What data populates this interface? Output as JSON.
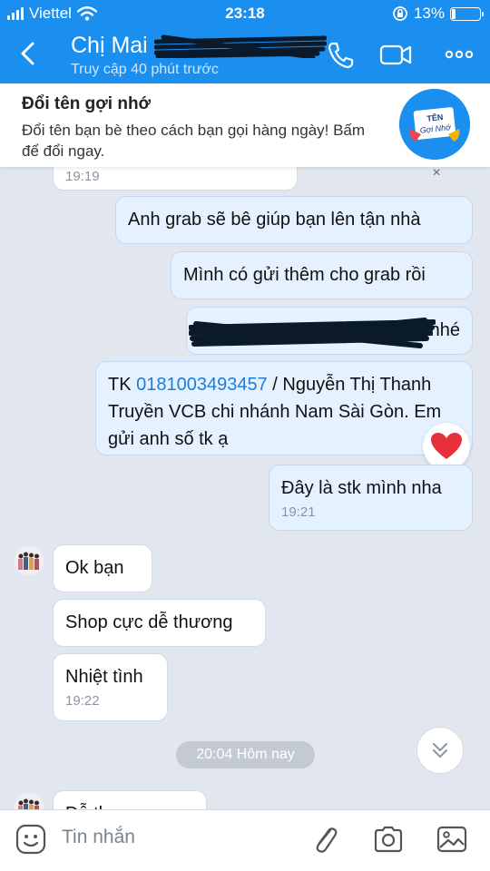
{
  "status_bar": {
    "carrier": "Viettel",
    "time": "23:18",
    "battery_percent": "13%",
    "battery_level": 0.13,
    "icons": [
      "signal-icon",
      "wifi-icon",
      "orientation-lock-icon",
      "battery-icon"
    ]
  },
  "header": {
    "contact_name": "Chị Mai",
    "contact_status": "Truy cập 40 phút trước",
    "icons": [
      "back-icon",
      "call-icon",
      "video-call-icon",
      "more-icon"
    ]
  },
  "banner": {
    "title": "Đổi tên gợi nhớ",
    "description": "Đổi tên bạn bè theo cách bạn gọi hàng ngày! Bấm để đổi ngay.",
    "badge_line1": "TÊN",
    "badge_line2": "Gợi Nhớ",
    "close_label": "×"
  },
  "messages": {
    "m0_time": "19:19",
    "m1": "Anh grab sẽ bê giúp bạn lên tận nhà",
    "m2": "Mình có gửi thêm cho grab rồi",
    "m3_end": "nhé",
    "m4_prefix": "TK ",
    "m4_account": "0181003493457",
    "m4_rest": " / Nguyễn Thị Thanh Truyền VCB chi nhánh Nam Sài Gòn. Em gửi anh số tk ạ",
    "m5": "Đây là stk mình nha",
    "m5_time": "19:21",
    "m6": "Ok bạn",
    "m7": "Shop cực dễ thương",
    "m8": "Nhiệt tình",
    "m8_time": "19:22",
    "date_separator": "20:04 Hôm nay",
    "m9_partial": "Dễ thương"
  },
  "reaction": {
    "icon": "heart-icon",
    "color": "#e8303a"
  },
  "input_bar": {
    "placeholder": "Tin nhắn",
    "icons": [
      "sticker-icon",
      "attach-icon",
      "camera-icon",
      "image-icon"
    ]
  },
  "colors": {
    "brand": "#1a8ff0",
    "outgoing_bubble": "#e5f1ff",
    "chat_background": "#e2e7ef",
    "link": "#1a7ee0"
  }
}
